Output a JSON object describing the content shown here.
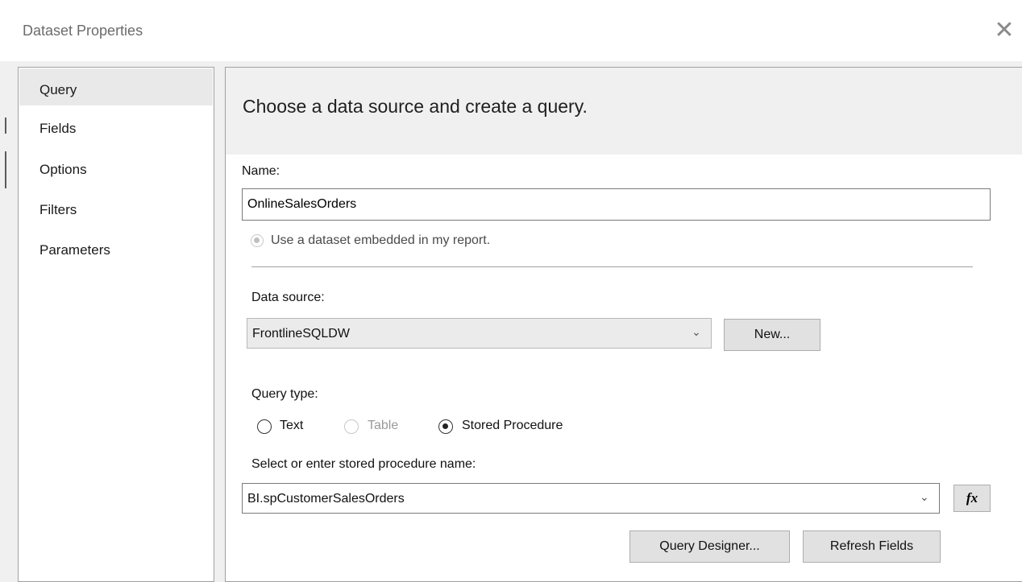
{
  "window": {
    "title": "Dataset Properties",
    "close_glyph": "✕"
  },
  "nav": {
    "items": [
      {
        "label": "Query",
        "selected": true
      },
      {
        "label": "Fields",
        "selected": false
      },
      {
        "label": "Options",
        "selected": false
      },
      {
        "label": "Filters",
        "selected": false
      },
      {
        "label": "Parameters",
        "selected": false
      }
    ]
  },
  "content": {
    "header": "Choose a data source and create a query.",
    "name_label": "Name:",
    "name_value": "OnlineSalesOrders",
    "embedded_option": "Use a dataset embedded in my report.",
    "data_source_label": "Data source:",
    "data_source_value": "FrontlineSQLDW",
    "new_button": "New...",
    "query_type_label": "Query type:",
    "query_types": [
      {
        "label": "Text",
        "checked": false,
        "enabled": true
      },
      {
        "label": "Table",
        "checked": false,
        "enabled": false
      },
      {
        "label": "Stored Procedure",
        "checked": true,
        "enabled": true
      }
    ],
    "sp_label": "Select or enter stored procedure name:",
    "sp_value": "BI.spCustomerSalesOrders",
    "fx_button": "fx",
    "query_designer_button": "Query Designer...",
    "refresh_fields_button": "Refresh Fields"
  },
  "icons": {
    "dropdown": "chevron-down-icon",
    "close": "close-icon",
    "expression": "fx-icon"
  }
}
